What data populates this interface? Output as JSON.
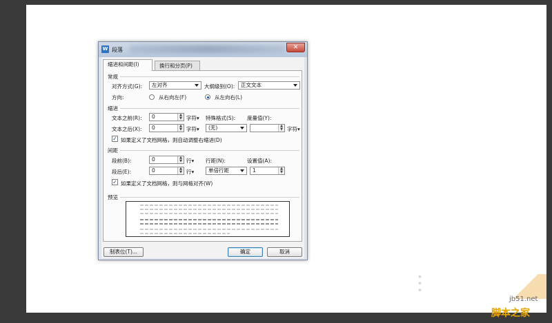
{
  "dialog": {
    "title": "段落",
    "app_icon": "W",
    "close_glyph": "✕",
    "tabs": [
      "缩进和间距(I)",
      "换行和分页(P)"
    ]
  },
  "general": {
    "heading": "常规",
    "align_label": "对齐方式(G):",
    "align_value": "左对齐",
    "outline_label": "大纲级别(O):",
    "outline_value": "正文文本",
    "direction_label": "方向:",
    "rtl_label": "从右向左(F)",
    "ltr_label": "从左向右(L)"
  },
  "indent": {
    "heading": "缩进",
    "before_label": "文本之前(R):",
    "before_value": "0",
    "after_label": "文本之后(X):",
    "after_value": "0",
    "unit_char": "字符▾",
    "special_label": "特殊格式(S):",
    "special_value": "(无)",
    "measure_label": "度量值(Y):",
    "measure_value": "",
    "grid_check_label": "如果定义了文档网格，则自动调整右缩进(D)"
  },
  "spacing": {
    "heading": "间距",
    "before_label": "段前(B):",
    "before_value": "0",
    "after_label": "段后(E):",
    "after_value": "0",
    "unit_line": "行▾",
    "line_label": "行距(N):",
    "line_value": "单倍行距",
    "setting_label": "设置值(A):",
    "setting_value": "1",
    "grid_check_label": "如果定义了文档网格，则与网格对齐(W)"
  },
  "preview": {
    "heading": "预览"
  },
  "buttons": {
    "tabs": "制表位(T)...",
    "ok": "确定",
    "cancel": "取消"
  },
  "watermark": {
    "site": "jb51.net",
    "name": "脚本之家"
  }
}
